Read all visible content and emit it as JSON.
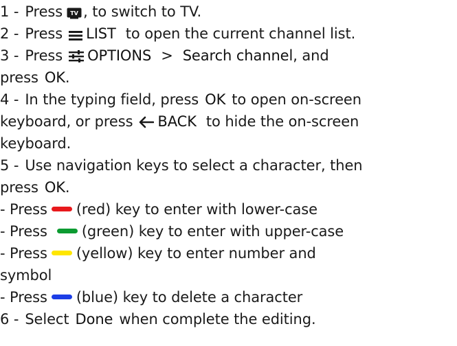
{
  "steps": {
    "s1": {
      "num": "1 -",
      "press": "Press",
      "rest": ", to switch to TV."
    },
    "s2": {
      "num": "2 -",
      "press": "Press",
      "key": "LIST",
      "rest": "to open the current channel list."
    },
    "s3": {
      "num": "3 -",
      "press": "Press",
      "key": "OPTIONS",
      "arrow": ">",
      "item": "Search channel",
      "rest": ", and",
      "press2": "press",
      "ok": "OK",
      "end": "."
    },
    "s4": {
      "num": "4 -",
      "text": "In the typing field, press",
      "ok": "OK",
      "rest": "to open on-screen",
      "line2a": "keyboard, or press",
      "back": "BACK",
      "line2b": "to hide the on-screen",
      "line3": "keyboard."
    },
    "s5": {
      "num": "5 -",
      "text": "Use navigation keys to select a character, then",
      "press": "press",
      "ok": "OK",
      "end": "."
    },
    "color_keys": [
      {
        "press": "- Press",
        "color": "#e8191c",
        "text": "(red) key to enter with lower-case"
      },
      {
        "press": "- Press",
        "color": "#0c9b31",
        "text": "(green) key to enter with upper-case"
      },
      {
        "press": "- Press",
        "color": "#ffe600",
        "text": "(yellow) key to enter number and",
        "cont": "symbol"
      },
      {
        "press": "- Press",
        "color": "#1c3ee6",
        "text": "(blue) key to delete a character"
      }
    ],
    "s6": {
      "num": "6 -",
      "text": "Select",
      "done": "Done",
      "rest": "when complete the editing."
    }
  },
  "icons": {
    "tv": "tv-icon",
    "list": "list-icon",
    "options": "options-sliders-icon",
    "back": "back-arrow-icon"
  }
}
